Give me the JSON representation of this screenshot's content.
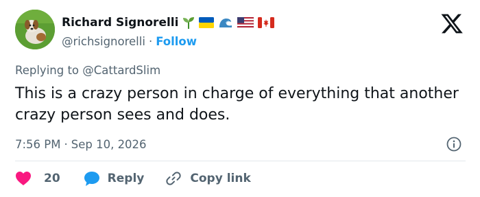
{
  "author": {
    "display_name": "Richard Signorelli",
    "handle": "@richsignorelli",
    "separator": "·",
    "follow_label": "Follow",
    "name_emojis": [
      "seedling-icon",
      "ukraine-flag-icon",
      "wave-icon",
      "us-flag-icon",
      "canada-flag-icon"
    ]
  },
  "reply_context": {
    "prefix": "Replying to",
    "handle": "@CattardSlim"
  },
  "tweet": {
    "text": "This is a crazy person in charge of everything that another crazy person sees and does.",
    "time": "7:56 PM",
    "separator": "·",
    "date": "Sep 10, 2026"
  },
  "actions": {
    "like_count": "20",
    "reply_label": "Reply",
    "copy_link_label": "Copy link"
  },
  "colors": {
    "like_red": "#f91880",
    "reply_blue": "#1d9bf0",
    "follow_blue": "#1d9bf0",
    "secondary_text": "#536471",
    "primary_text": "#0f1419"
  }
}
